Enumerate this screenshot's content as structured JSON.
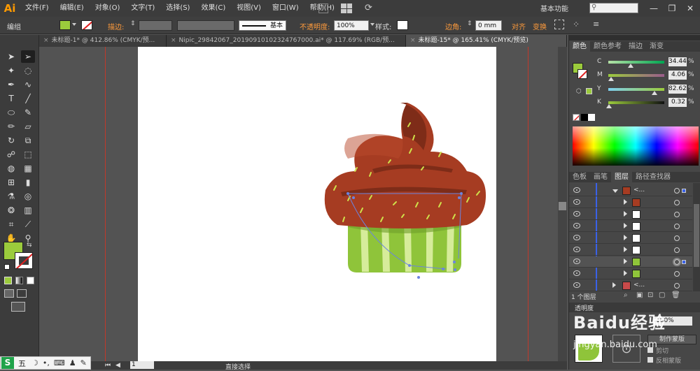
{
  "app": {
    "logo": "Ai"
  },
  "menu": [
    "文件(F)",
    "编辑(E)",
    "对象(O)",
    "文字(T)",
    "选择(S)",
    "效果(C)",
    "视图(V)",
    "窗口(W)",
    "帮助(H)"
  ],
  "workspace": "基本功能",
  "control_bar": {
    "mode": "编组",
    "stroke_label": "描边:",
    "stroke_style": "基本",
    "opacity_label": "不透明度:",
    "opacity_value": "100%",
    "style_label": "样式:",
    "corner_label": "边角:",
    "corner_value": "0 mm",
    "align_label": "对齐",
    "transform_label": "变换",
    "fill_color": "#9bcb3c"
  },
  "doc_tabs": [
    {
      "label": "未标题-1* @ 412.86% (CMYK/预...",
      "active": false
    },
    {
      "label": "Nipic_29842067_20190910102324767000.ai* @ 117.69% (RGB/预...",
      "active": false
    },
    {
      "label": "未标题-15* @ 165.41% (CMYK/预览)",
      "active": true
    }
  ],
  "color_panel": {
    "tabs": [
      "颜色",
      "颜色参考",
      "描边",
      "渐变"
    ],
    "channels": [
      {
        "name": "C",
        "value": "34.44",
        "pos": 0.34,
        "gradient": "linear-gradient(to right,#b5e2a6,#00a651)"
      },
      {
        "name": "M",
        "value": "4.06",
        "pos": 0.04,
        "gradient": "linear-gradient(to right,#9bcb3c,#9b5c8c)"
      },
      {
        "name": "Y",
        "value": "82.62",
        "pos": 0.83,
        "gradient": "linear-gradient(to right,#7fd0f0,#9bcb3c)"
      },
      {
        "name": "K",
        "value": "0.32",
        "pos": 0.01,
        "gradient": "linear-gradient(to right,#9bcb3c,#111111)"
      }
    ],
    "pct": "%"
  },
  "layers_panel": {
    "tabs": [
      "色板",
      "画笔",
      "图层",
      "路径查找器"
    ],
    "top_layer": "<...",
    "bottom_layer": "<...",
    "layer_count": "1 个图层"
  },
  "lower_panel": {
    "title": "透明度",
    "opacity": "100%",
    "make_mask": "制作蒙版",
    "clip": "剪切",
    "invert_mask": "反相蒙版"
  },
  "watermark": "Baidu经验",
  "watermark_sub": "jingyan.baidu.com",
  "status": {
    "zoom": "165.41%",
    "page": "1",
    "tool": "直接选择"
  },
  "taskbar": [
    "S",
    "五"
  ]
}
